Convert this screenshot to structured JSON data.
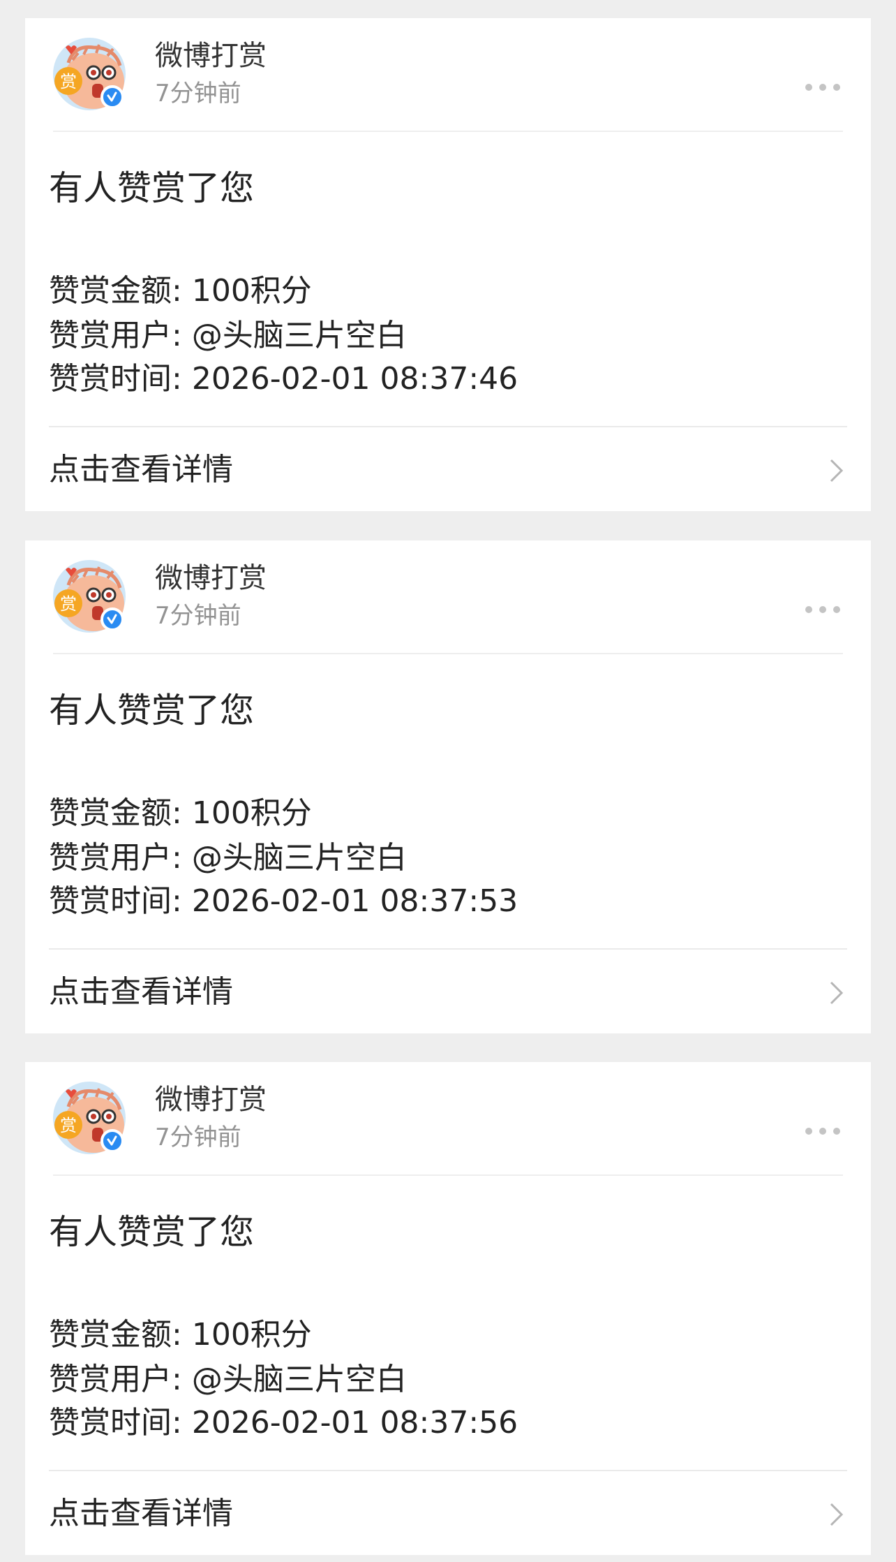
{
  "notifications": [
    {
      "sender": "微博打赏",
      "time": "7分钟前",
      "title": "有人赞赏了您",
      "amount_label": "赞赏金额:",
      "amount_value": "100积分",
      "user_label": "赞赏用户:",
      "user_value": "@头脑三片空白",
      "time_label": "赞赏时间:",
      "time_value": "2026-02-01 08:37:46",
      "link_label": "点击查看详情"
    },
    {
      "sender": "微博打赏",
      "time": "7分钟前",
      "title": "有人赞赏了您",
      "amount_label": "赞赏金额:",
      "amount_value": "100积分",
      "user_label": "赞赏用户:",
      "user_value": "@头脑三片空白",
      "time_label": "赞赏时间:",
      "time_value": "2026-02-01 08:37:53",
      "link_label": "点击查看详情"
    },
    {
      "sender": "微博打赏",
      "time": "7分钟前",
      "title": "有人赞赏了您",
      "amount_label": "赞赏金额:",
      "amount_value": "100积分",
      "user_label": "赞赏用户:",
      "user_value": "@头脑三片空白",
      "time_label": "赞赏时间:",
      "time_value": "2026-02-01 08:37:56",
      "link_label": "点击查看详情"
    }
  ],
  "icons": {
    "avatar": "weibo-reward-mascot-avatar",
    "verified": "verified-badge-icon",
    "more": "more-options-icon",
    "chevron": "chevron-right-icon"
  },
  "colors": {
    "background": "#eeeeee",
    "card": "#ffffff",
    "muted_text": "#939393",
    "verified_blue": "#2a8bf2",
    "reward_badge_orange": "#f5a623"
  }
}
